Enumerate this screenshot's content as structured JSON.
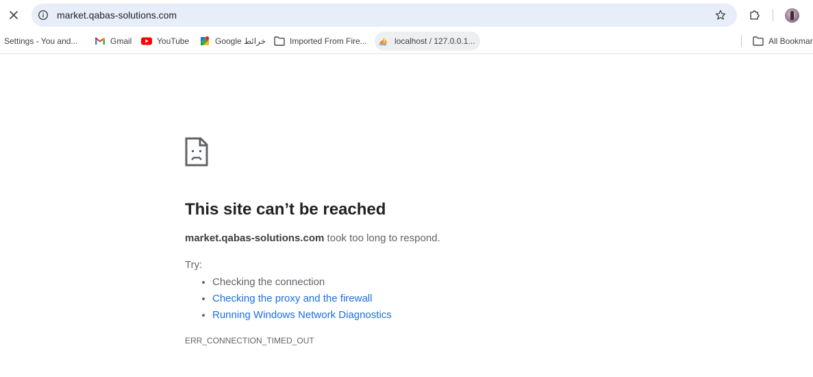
{
  "toolbar": {
    "stop_icon": "close-icon",
    "url": "market.qabas-solutions.com",
    "site_info_icon": "info-icon",
    "bookmark_star_icon": "star-icon",
    "extensions_icon": "puzzle-icon"
  },
  "bookmarks": {
    "items": [
      {
        "label": "Settings - You and...",
        "icon": "none"
      },
      {
        "label": "Gmail",
        "icon": "gmail-icon"
      },
      {
        "label": "YouTube",
        "icon": "youtube-icon"
      },
      {
        "label": "Google خرائط",
        "icon": "google-maps-icon"
      },
      {
        "label": "Imported From Fire...",
        "icon": "folder-icon"
      },
      {
        "label": "localhost / 127.0.0.1...",
        "icon": "phpmyadmin-icon"
      }
    ],
    "all_bookmarks": "All Bookmar"
  },
  "error": {
    "title": "This site can’t be reached",
    "host": "market.qabas-solutions.com",
    "message_suffix": " took too long to respond.",
    "try_label": "Try:",
    "suggestions": [
      "Checking the connection",
      "Checking the proxy and the firewall",
      "Running Windows Network Diagnostics"
    ],
    "code": "ERR_CONNECTION_TIMED_OUT"
  },
  "colors": {
    "omnibox_bg": "#e8eef9",
    "link": "#1a6ee3",
    "text_primary": "#202124",
    "text_secondary": "#5f6368"
  }
}
